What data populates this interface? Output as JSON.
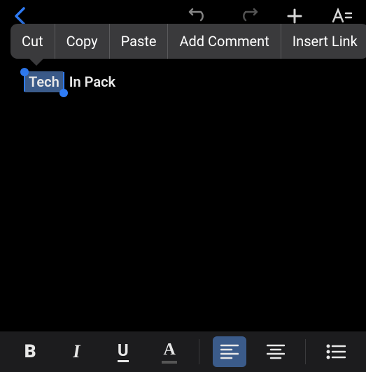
{
  "top_toolbar": {
    "back_icon": "back",
    "undo_icon": "undo",
    "redo_icon": "redo",
    "add_icon": "plus",
    "more_icon": "text-format"
  },
  "context_menu": {
    "items": [
      {
        "label": "Cut"
      },
      {
        "label": "Copy"
      },
      {
        "label": "Paste"
      },
      {
        "label": "Add Comment"
      },
      {
        "label": "Insert Link"
      }
    ]
  },
  "document": {
    "selected_text": "Tech",
    "rest_of_line": "In Pack"
  },
  "format_toolbar": {
    "bold": "B",
    "italic": "I",
    "underline": "U",
    "text_color": "A",
    "align_left_active": true
  },
  "colors": {
    "selection_bg": "#3b5b8a",
    "handle": "#2f7cf6",
    "menu_bg": "#3a3a3c",
    "bottom_bg": "#1c1c1e"
  }
}
